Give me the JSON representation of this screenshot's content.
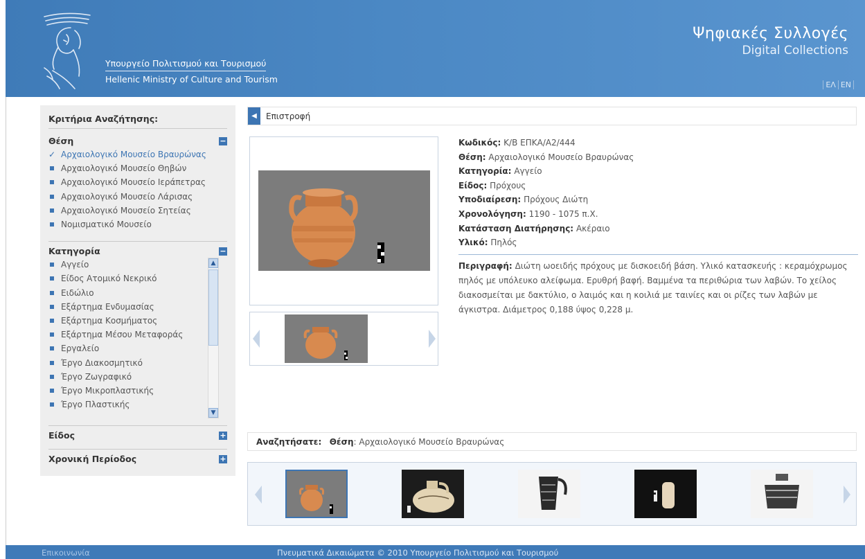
{
  "header": {
    "ministry_gr": "Υπουργείο Πολιτισμού και Τουρισμού",
    "ministry_en": "Hellenic Ministry of Culture and Tourism",
    "title_gr": "Ψηφιακές Συλλογές",
    "title_en": "Digital Collections",
    "lang_el": "ΕΛ",
    "lang_en": "EN"
  },
  "sidebar": {
    "heading": "Κριτήρια Αναζήτησης:",
    "location": {
      "title": "Θέση",
      "toggle": "−",
      "items": [
        "Αρχαιολογικό Μουσείο Βραυρώνας",
        "Αρχαιολογικό Μουσείο Θηβών",
        "Αρχαιολογικό Μουσείο Ιεράπετρας",
        "Αρχαιολογικό Μουσείο Λάρισας",
        "Αρχαιολογικό Μουσείο Σητείας",
        "Νομισματικό Μουσείο"
      ]
    },
    "category": {
      "title": "Κατηγορία",
      "toggle": "−",
      "items": [
        "Αγγείο",
        "Είδος Ατομικό Νεκρικό",
        "Ειδώλιο",
        "Εξάρτημα Ενδυμασίας",
        "Εξάρτημα Κοσμήματος",
        "Εξάρτημα Μέσου Μεταφοράς",
        "Εργαλείο",
        "Έργο Διακοσμητικό",
        "Έργο Ζωγραφικό",
        "Έργο Μικροπλαστικής",
        "Έργο Πλαστικής"
      ]
    },
    "type": {
      "title": "Είδος",
      "toggle": "+"
    },
    "period": {
      "title": "Χρονική Περίοδος",
      "toggle": "+"
    }
  },
  "back": {
    "label": "Επιστροφή"
  },
  "details": {
    "code_label": "Κωδικός:",
    "code": "Κ/Β ΕΠΚΑ/Α2/444",
    "location_label": "Θέση:",
    "location": "Αρχαιολογικό Μουσείο Βραυρώνας",
    "category_label": "Κατηγορία:",
    "category": "Αγγείο",
    "type_label": "Είδος:",
    "type": "Πρόχους",
    "subdivision_label": "Υποδιαίρεση:",
    "subdivision": "Πρόχους Διώτη",
    "dating_label": "Χρονολόγηση:",
    "dating": "1190 - 1075 π.Χ.",
    "condition_label": "Κατάσταση Διατήρησης:",
    "condition": "Ακέραιο",
    "material_label": "Υλικό:",
    "material": "Πηλός",
    "description_label": "Περιγραφή:",
    "description": "Διώτη ωοειδής πρόχους με δισκοειδή βάση. Υλικό κατασκευής : κεραμόχρωμος πηλός με υπόλευκο αλείφωμα. Ερυθρή βαφή. Βαμμένα τα περιθώρια των λαβών. Το χείλος διακοσμείται με δακτύλιο, ο λαιμός και η κοιλιά με ταινίες και οι ρίζες των λαβών με άγκιστρα. Διάμετρος 0,188 ύψος 0,228 μ."
  },
  "search_summary": {
    "label": "Αναζητήσατε:",
    "field_label": "Θέση",
    "value": ": Αρχαιολογικό Μουσείο Βραυρώνας"
  },
  "footer": {
    "contact": "Επικοινωνία",
    "copyright": "Πνευματικά Δικαιώματα © 2010 Υπουργείο Πολιτισμού και Τουρισμού"
  },
  "colors": {
    "brand_blue": "#3d75b3",
    "sidebar_bg": "#eeeeee"
  }
}
